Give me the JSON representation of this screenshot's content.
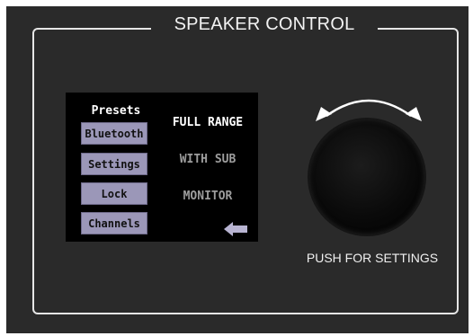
{
  "panel": {
    "title": "SPEAKER CONTROL",
    "push_label": "PUSH FOR SETTINGS"
  },
  "screen": {
    "presets_label": "Presets",
    "side_buttons": [
      "Bluetooth",
      "Settings",
      "Lock",
      "Channels"
    ],
    "presets": [
      {
        "label": "FULL RANGE",
        "active": true
      },
      {
        "label": "WITH SUB",
        "active": false
      },
      {
        "label": "MONITOR",
        "active": false
      }
    ]
  },
  "icons": {
    "back": "back-arrow-icon",
    "rotate": "rotate-arrows-icon"
  },
  "colors": {
    "panel_bg": "#2a2a2a",
    "button_bg": "#9b97b8",
    "active_text": "#ffffff",
    "inactive_text": "#9d9d9d"
  }
}
